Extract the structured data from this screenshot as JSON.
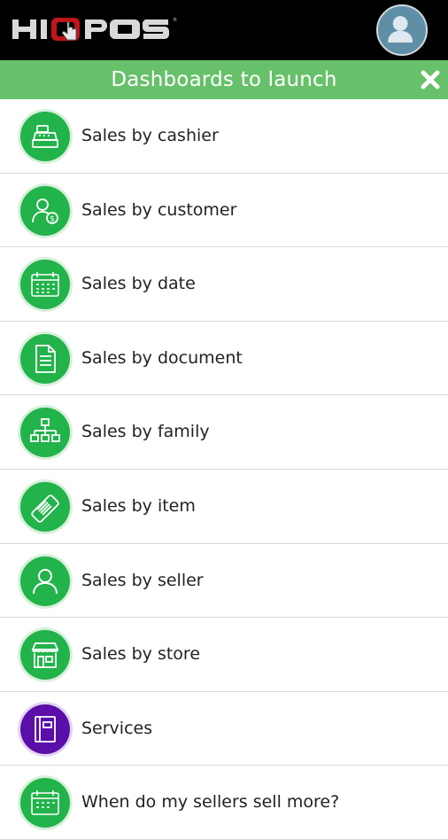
{
  "app": {
    "logo_text": "HIOPOS"
  },
  "dialog": {
    "title": "Dashboards to launch"
  },
  "items": [
    {
      "label": "Sales by cashier",
      "icon": "cash-register-icon",
      "color": "#22b34b"
    },
    {
      "label": "Sales by customer",
      "icon": "customer-dollar-icon",
      "color": "#22b34b"
    },
    {
      "label": "Sales by date",
      "icon": "calendar-icon",
      "color": "#22b34b"
    },
    {
      "label": "Sales by document",
      "icon": "document-icon",
      "color": "#22b34b"
    },
    {
      "label": "Sales by family",
      "icon": "hierarchy-icon",
      "color": "#22b34b"
    },
    {
      "label": "Sales by item",
      "icon": "barcode-tag-icon",
      "color": "#22b34b"
    },
    {
      "label": "Sales by seller",
      "icon": "person-icon",
      "color": "#22b34b"
    },
    {
      "label": "Sales by store",
      "icon": "store-icon",
      "color": "#22b34b"
    },
    {
      "label": "Services",
      "icon": "binder-icon",
      "color": "#5a0fa8"
    },
    {
      "label": "When do my sellers sell more?",
      "icon": "calendar-icon",
      "color": "#22b34b"
    }
  ],
  "colors": {
    "accent": "#67c06a",
    "icon_green": "#22b34b",
    "icon_purple": "#5a0fa8",
    "topbar": "#000000"
  }
}
